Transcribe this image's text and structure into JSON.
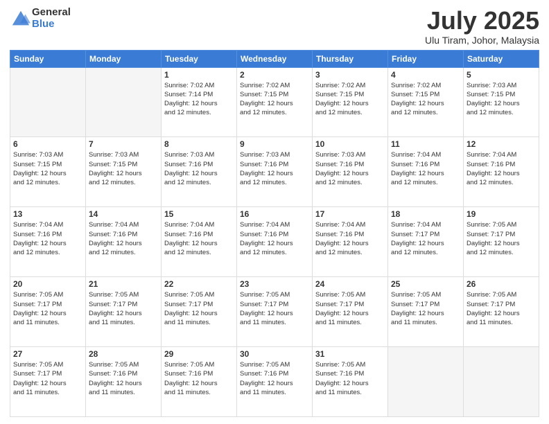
{
  "logo": {
    "general": "General",
    "blue": "Blue"
  },
  "title": "July 2025",
  "location": "Ulu Tiram, Johor, Malaysia",
  "days_of_week": [
    "Sunday",
    "Monday",
    "Tuesday",
    "Wednesday",
    "Thursday",
    "Friday",
    "Saturday"
  ],
  "weeks": [
    [
      {
        "day": "",
        "info": ""
      },
      {
        "day": "",
        "info": ""
      },
      {
        "day": "1",
        "info": "Sunrise: 7:02 AM\nSunset: 7:14 PM\nDaylight: 12 hours\nand 12 minutes."
      },
      {
        "day": "2",
        "info": "Sunrise: 7:02 AM\nSunset: 7:15 PM\nDaylight: 12 hours\nand 12 minutes."
      },
      {
        "day": "3",
        "info": "Sunrise: 7:02 AM\nSunset: 7:15 PM\nDaylight: 12 hours\nand 12 minutes."
      },
      {
        "day": "4",
        "info": "Sunrise: 7:02 AM\nSunset: 7:15 PM\nDaylight: 12 hours\nand 12 minutes."
      },
      {
        "day": "5",
        "info": "Sunrise: 7:03 AM\nSunset: 7:15 PM\nDaylight: 12 hours\nand 12 minutes."
      }
    ],
    [
      {
        "day": "6",
        "info": "Sunrise: 7:03 AM\nSunset: 7:15 PM\nDaylight: 12 hours\nand 12 minutes."
      },
      {
        "day": "7",
        "info": "Sunrise: 7:03 AM\nSunset: 7:15 PM\nDaylight: 12 hours\nand 12 minutes."
      },
      {
        "day": "8",
        "info": "Sunrise: 7:03 AM\nSunset: 7:16 PM\nDaylight: 12 hours\nand 12 minutes."
      },
      {
        "day": "9",
        "info": "Sunrise: 7:03 AM\nSunset: 7:16 PM\nDaylight: 12 hours\nand 12 minutes."
      },
      {
        "day": "10",
        "info": "Sunrise: 7:03 AM\nSunset: 7:16 PM\nDaylight: 12 hours\nand 12 minutes."
      },
      {
        "day": "11",
        "info": "Sunrise: 7:04 AM\nSunset: 7:16 PM\nDaylight: 12 hours\nand 12 minutes."
      },
      {
        "day": "12",
        "info": "Sunrise: 7:04 AM\nSunset: 7:16 PM\nDaylight: 12 hours\nand 12 minutes."
      }
    ],
    [
      {
        "day": "13",
        "info": "Sunrise: 7:04 AM\nSunset: 7:16 PM\nDaylight: 12 hours\nand 12 minutes."
      },
      {
        "day": "14",
        "info": "Sunrise: 7:04 AM\nSunset: 7:16 PM\nDaylight: 12 hours\nand 12 minutes."
      },
      {
        "day": "15",
        "info": "Sunrise: 7:04 AM\nSunset: 7:16 PM\nDaylight: 12 hours\nand 12 minutes."
      },
      {
        "day": "16",
        "info": "Sunrise: 7:04 AM\nSunset: 7:16 PM\nDaylight: 12 hours\nand 12 minutes."
      },
      {
        "day": "17",
        "info": "Sunrise: 7:04 AM\nSunset: 7:16 PM\nDaylight: 12 hours\nand 12 minutes."
      },
      {
        "day": "18",
        "info": "Sunrise: 7:04 AM\nSunset: 7:17 PM\nDaylight: 12 hours\nand 12 minutes."
      },
      {
        "day": "19",
        "info": "Sunrise: 7:05 AM\nSunset: 7:17 PM\nDaylight: 12 hours\nand 12 minutes."
      }
    ],
    [
      {
        "day": "20",
        "info": "Sunrise: 7:05 AM\nSunset: 7:17 PM\nDaylight: 12 hours\nand 11 minutes."
      },
      {
        "day": "21",
        "info": "Sunrise: 7:05 AM\nSunset: 7:17 PM\nDaylight: 12 hours\nand 11 minutes."
      },
      {
        "day": "22",
        "info": "Sunrise: 7:05 AM\nSunset: 7:17 PM\nDaylight: 12 hours\nand 11 minutes."
      },
      {
        "day": "23",
        "info": "Sunrise: 7:05 AM\nSunset: 7:17 PM\nDaylight: 12 hours\nand 11 minutes."
      },
      {
        "day": "24",
        "info": "Sunrise: 7:05 AM\nSunset: 7:17 PM\nDaylight: 12 hours\nand 11 minutes."
      },
      {
        "day": "25",
        "info": "Sunrise: 7:05 AM\nSunset: 7:17 PM\nDaylight: 12 hours\nand 11 minutes."
      },
      {
        "day": "26",
        "info": "Sunrise: 7:05 AM\nSunset: 7:17 PM\nDaylight: 12 hours\nand 11 minutes."
      }
    ],
    [
      {
        "day": "27",
        "info": "Sunrise: 7:05 AM\nSunset: 7:17 PM\nDaylight: 12 hours\nand 11 minutes."
      },
      {
        "day": "28",
        "info": "Sunrise: 7:05 AM\nSunset: 7:16 PM\nDaylight: 12 hours\nand 11 minutes."
      },
      {
        "day": "29",
        "info": "Sunrise: 7:05 AM\nSunset: 7:16 PM\nDaylight: 12 hours\nand 11 minutes."
      },
      {
        "day": "30",
        "info": "Sunrise: 7:05 AM\nSunset: 7:16 PM\nDaylight: 12 hours\nand 11 minutes."
      },
      {
        "day": "31",
        "info": "Sunrise: 7:05 AM\nSunset: 7:16 PM\nDaylight: 12 hours\nand 11 minutes."
      },
      {
        "day": "",
        "info": ""
      },
      {
        "day": "",
        "info": ""
      }
    ]
  ]
}
